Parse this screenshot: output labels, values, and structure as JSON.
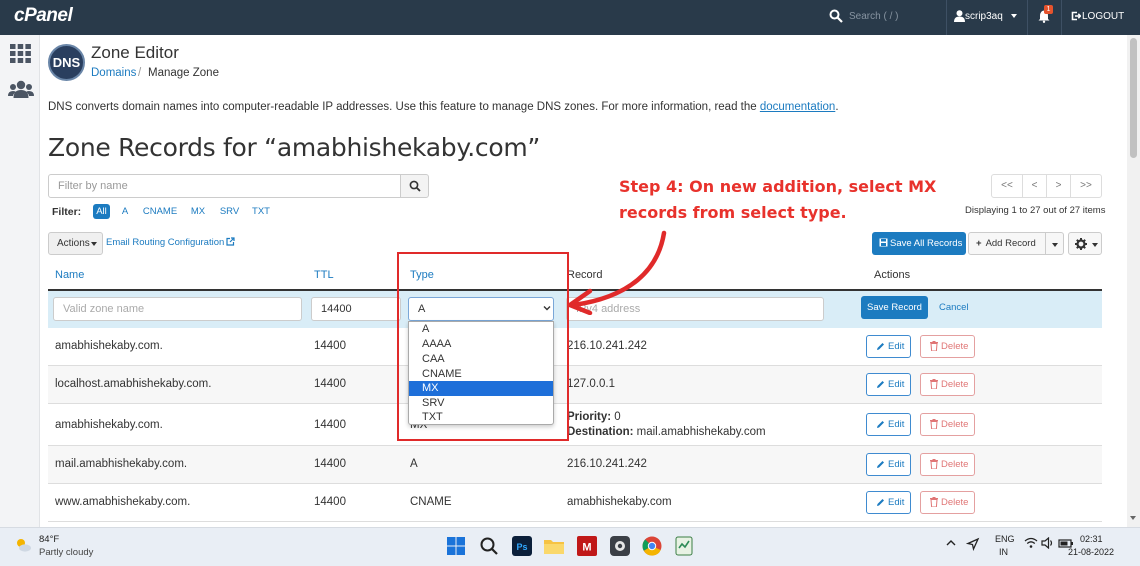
{
  "topbar": {
    "logo": "cPanel",
    "search_placeholder": "Search ( / )",
    "username": "scrip3aq",
    "notification_count": "1",
    "logout_label": "LOGOUT"
  },
  "header": {
    "logo_text": "DNS",
    "title": "Zone Editor",
    "breadcrumb_link": "Domains",
    "breadcrumb_sep": "/",
    "breadcrumb_current": "Manage Zone"
  },
  "intro": {
    "text": "DNS converts domain names into computer-readable IP addresses. Use this feature to manage DNS zones. For more information, read the ",
    "link": "documentation",
    "end": "."
  },
  "zone_heading": "Zone Records for “amabhishekaby.com”",
  "filter": {
    "placeholder": "Filter by name",
    "label": "Filter:",
    "chips": [
      "All",
      "A",
      "CNAME",
      "MX",
      "SRV",
      "TXT"
    ]
  },
  "pagination": {
    "first": "<<",
    "prev": "<",
    "next": ">",
    "last": ">>",
    "info": "Displaying 1 to 27 out of 27 items"
  },
  "toolbar": {
    "actions": "Actions",
    "email_routing": "Email Routing Configuration",
    "save_all": "Save All Records",
    "add_record": "Add Record"
  },
  "table": {
    "headers": {
      "name": "Name",
      "ttl": "TTL",
      "type": "Type",
      "record": "Record",
      "actions": "Actions"
    },
    "edit_row": {
      "name_placeholder": "Valid zone name",
      "ttl": "14400",
      "type_selected": "A",
      "record_placeholder": "IPv4 address",
      "save": "Save Record",
      "cancel": "Cancel"
    },
    "edit_label": "Edit",
    "delete_label": "Delete",
    "priority_label": "Priority:",
    "destination_label": "Destination:",
    "rows": [
      {
        "name": "amabhishekaby.com.",
        "ttl": "14400",
        "type": "",
        "record": "216.10.241.242"
      },
      {
        "name": "localhost.amabhishekaby.com.",
        "ttl": "14400",
        "type": "",
        "record": "127.0.0.1"
      },
      {
        "name": "amabhishekaby.com.",
        "ttl": "14400",
        "type": "MX",
        "priority": "0",
        "destination": "mail.amabhishekaby.com"
      },
      {
        "name": "mail.amabhishekaby.com.",
        "ttl": "14400",
        "type": "A",
        "record": "216.10.241.242"
      },
      {
        "name": "www.amabhishekaby.com.",
        "ttl": "14400",
        "type": "CNAME",
        "record": "amabhishekaby.com"
      }
    ]
  },
  "type_dropdown": {
    "options": [
      "A",
      "AAAA",
      "CAA",
      "CNAME",
      "MX",
      "SRV",
      "TXT"
    ],
    "highlighted": "MX"
  },
  "annotation": {
    "line1": "Step 4: On new addition, select MX",
    "line2": "records from select type."
  },
  "taskbar": {
    "temperature": "84°F",
    "condition": "Partly cloudy",
    "lang1": "ENG",
    "lang2": "IN",
    "time": "02:31",
    "date": "21-08-2022"
  },
  "colors": {
    "topbar": "#293a4a",
    "link": "#1c7bc0",
    "annotation": "#e8322c",
    "edit_row_bg": "#d9edf7",
    "dropdown_highlight": "#1e6fd9"
  }
}
